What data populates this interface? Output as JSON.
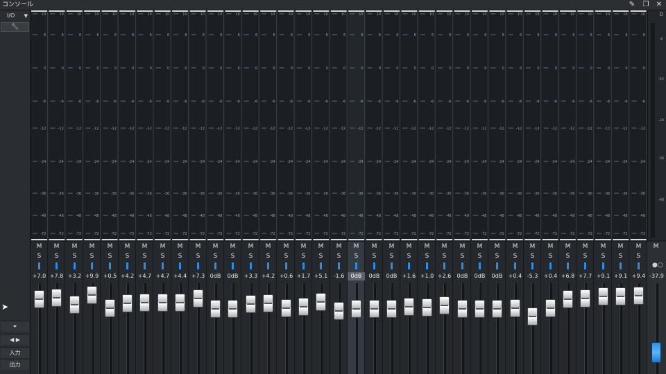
{
  "window": {
    "title": "コンソール"
  },
  "titlebar_icons": [
    "pin-icon",
    "restore-icon",
    "close-icon"
  ],
  "sidebar": {
    "io_label": "I/O",
    "tool_icon": "wrench-icon",
    "buttons": [
      {
        "name": "expand-collapse-button",
        "label": "⏷"
      },
      {
        "name": "scroll-channels-button",
        "label": "◀ ▶"
      },
      {
        "name": "input-button",
        "label": "入力"
      },
      {
        "name": "output-button",
        "label": "出力"
      }
    ]
  },
  "meter_scale": [
    "10",
    "6",
    "0",
    "-6",
    "-12",
    "-24",
    "-36",
    "-48",
    "-72"
  ],
  "right_meter_scale": [
    "0",
    "-6",
    "-12",
    "-24",
    "-36",
    "-48"
  ],
  "right_meter_value": "0",
  "mute_label": "M",
  "solo_label": "S",
  "channels": [
    {
      "value": "+7.0",
      "fader": 7.0
    },
    {
      "value": "+7.8",
      "fader": 7.8
    },
    {
      "value": "+3.2",
      "fader": 3.2
    },
    {
      "value": "+9.9",
      "fader": 9.9
    },
    {
      "value": "+0.5",
      "fader": 0.5
    },
    {
      "value": "+4.2",
      "fader": 4.2
    },
    {
      "value": "+4.7",
      "fader": 4.7
    },
    {
      "value": "+4.7",
      "fader": 4.7
    },
    {
      "value": "+4.4",
      "fader": 4.4
    },
    {
      "value": "+7.3",
      "fader": 7.3
    },
    {
      "value": "0dB",
      "fader": 0
    },
    {
      "value": "0dB",
      "fader": 0
    },
    {
      "value": "+3.3",
      "fader": 3.3
    },
    {
      "value": "+4.2",
      "fader": 4.2
    },
    {
      "value": "+0.6",
      "fader": 0.6
    },
    {
      "value": "+1.7",
      "fader": 1.7
    },
    {
      "value": "+5.1",
      "fader": 5.1
    },
    {
      "value": "-1.6",
      "fader": -1.6
    },
    {
      "value": "0dB",
      "fader": 0,
      "selected": true
    },
    {
      "value": "0dB",
      "fader": 0
    },
    {
      "value": "0dB",
      "fader": 0
    },
    {
      "value": "+1.6",
      "fader": 1.6
    },
    {
      "value": "+1.0",
      "fader": 1.0
    },
    {
      "value": "+2.6",
      "fader": 2.6
    },
    {
      "value": "0dB",
      "fader": 0
    },
    {
      "value": "0dB",
      "fader": 0
    },
    {
      "value": "0dB",
      "fader": 0
    },
    {
      "value": "+0.4",
      "fader": 0.4
    },
    {
      "value": "-5.3",
      "fader": -5.3
    },
    {
      "value": "+0.4",
      "fader": 0.4
    },
    {
      "value": "+6.8",
      "fader": 6.8
    },
    {
      "value": "+7.7",
      "fader": 7.7
    },
    {
      "value": "+9.1",
      "fader": 9.1
    },
    {
      "value": "+9.1",
      "fader": 9.1
    },
    {
      "value": "+9.4",
      "fader": 9.4
    }
  ],
  "master": {
    "mute_label": "M",
    "value": "-37.9",
    "link_icon": "link-toggle-icon"
  },
  "colors": {
    "pan": "#2f8be6",
    "master_fader": "#3a9cf0",
    "meter_tick": "#4e6f8c"
  }
}
